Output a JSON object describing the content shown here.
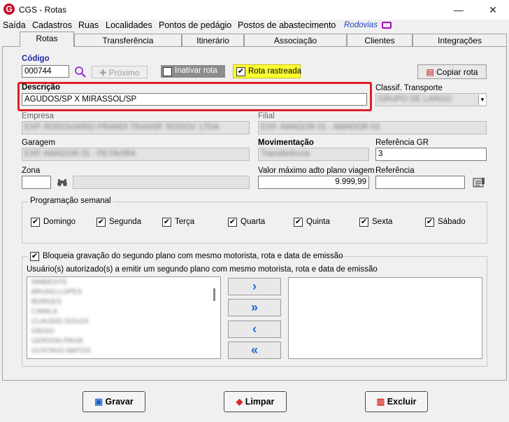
{
  "window": {
    "title": "CGS - Rotas",
    "logo_letter": "G",
    "minimize": "—",
    "close": "✕"
  },
  "menu": [
    "Saída",
    "Cadastros",
    "Ruas",
    "Localidades",
    "Pontos de pedágio",
    "Postos de abastecimento",
    "Rodovias"
  ],
  "tabs": [
    "Rotas",
    "Transferência",
    "Itinerário",
    "Associação",
    "Clientes",
    "Integrações"
  ],
  "form": {
    "codigo_label": "Código",
    "codigo_value": "000744",
    "proximo_label": "Próximo",
    "inativar_label": "Inativar rota",
    "rastreada_label": "Rota rastreada",
    "rastreada_check": "✔",
    "copiar_label": "Copiar rota",
    "descricao_label": "Descrição",
    "descricao_value": "AGUDOS/SP X MIRASSOL/SP",
    "classif_label": "Classif. Transporte",
    "classif_value": "GRUPO DE LARGO",
    "empresa_label": "Empresa",
    "empresa_value": "EXP. RODOVIARIO PRANDI TRANSP. RODOV. LTDA",
    "filial_label": "Filial",
    "filial_value": "EXP. AMADOR 01 - AMADOR 03",
    "garagem_label": "Garagem",
    "garagem_value": "EXP. AMADOR 01 - PETAVIRA",
    "movimentacao_label": "Movimentação",
    "movimentacao_value": "Transferência",
    "referencia_gr_label": "Referência GR",
    "referencia_gr_value": "3",
    "zona_label": "Zona",
    "valor_label": "Valor máximo adto plano viagem",
    "valor_value": "9.999,99",
    "referencia_label": "Referência"
  },
  "programacao": {
    "title": "Programação semanal",
    "check": "✔",
    "days": [
      "Domingo",
      "Segunda",
      "Terça",
      "Quarta",
      "Quinta",
      "Sexta",
      "Sábado"
    ]
  },
  "bloqueia": {
    "label": "Bloqueia gravação do segundo plano com mesmo motorista, rota e data de emissão",
    "check": "✔",
    "users_label": "Usuário(s) autorizado(s) a emitir um segundo plano com mesmo motorista, rota e data de emissão",
    "users": [
      "AMBIENTE",
      "BRUNO.LOPES",
      "BORGES",
      "CAMILA",
      "CLAUDIO.SOUZA",
      "DIEGO",
      "GERSON.PAIVA",
      "GUSTAVO.MATOS"
    ],
    "arrows": [
      "›",
      "»",
      "‹",
      "«"
    ]
  },
  "buttons": {
    "gravar": "Gravar",
    "limpar": "Limpar",
    "excluir": "Excluir"
  }
}
